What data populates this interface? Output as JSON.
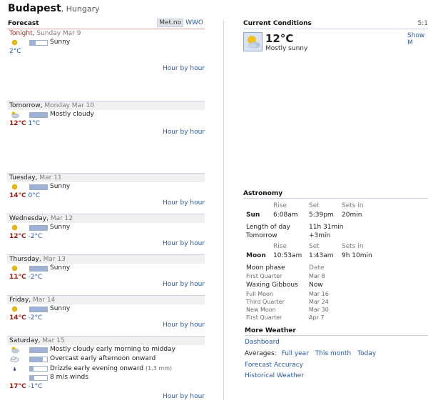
{
  "header": {
    "city": "Budapest",
    "country": ", Hungary"
  },
  "forecast": {
    "label": "Forecast",
    "sources": [
      "Met.no",
      "WWO"
    ],
    "hour_by_hour": "Hour by hour",
    "days": [
      {
        "name": "Tonight",
        "date": "Sunday Mar 9",
        "lines": [
          {
            "icon": "sun-icon",
            "bar": 0.35,
            "text": "Sunny",
            "note": ""
          }
        ],
        "high": "",
        "low": "2°C"
      },
      {
        "name": "Tomorrow",
        "date": "Monday Mar 10",
        "lines": [
          {
            "icon": "partly-cloudy-icon",
            "bar": 1,
            "text": "Mostly cloudy",
            "note": ""
          }
        ],
        "high": "12°C",
        "low": "1°C"
      },
      {
        "name": "Tuesday",
        "date": "Mar 11",
        "lines": [
          {
            "icon": "sun-icon",
            "bar": 1,
            "text": "Sunny",
            "note": ""
          }
        ],
        "high": "14°C",
        "low": "0°C"
      },
      {
        "name": "Wednesday",
        "date": "Mar 12",
        "lines": [
          {
            "icon": "sun-icon",
            "bar": 1,
            "text": "Sunny",
            "note": ""
          }
        ],
        "high": "12°C",
        "low": "-2°C"
      },
      {
        "name": "Thursday",
        "date": "Mar 13",
        "lines": [
          {
            "icon": "sun-icon",
            "bar": 1,
            "text": "Sunny",
            "note": ""
          }
        ],
        "high": "11°C",
        "low": "-2°C"
      },
      {
        "name": "Friday",
        "date": "Mar 14",
        "lines": [
          {
            "icon": "sun-icon",
            "bar": 1,
            "text": "Sunny",
            "note": ""
          }
        ],
        "high": "14°C",
        "low": "-2°C"
      },
      {
        "name": "Saturday",
        "date": "Mar 15",
        "lines": [
          {
            "icon": "partly-cloudy-icon",
            "bar": 1,
            "text": "Mostly cloudy early morning to midday",
            "note": ""
          },
          {
            "icon": "cloud-icon",
            "bar": 0.75,
            "text": "Overcast early afternoon onward",
            "note": ""
          },
          {
            "icon": "drizzle-icon",
            "bar": 0.2,
            "text": "Drizzle early evening onward",
            "note": "(1.3 mm)"
          },
          {
            "icon": "",
            "bar": 0.25,
            "text": "8 m/s winds",
            "note": ""
          }
        ],
        "high": "17°C",
        "low": "-1°C"
      }
    ]
  },
  "current": {
    "title": "Current Conditions",
    "time": "5:1",
    "temp": "12°C",
    "desc": "Mostly sunny",
    "show_more": "Show M",
    "icon": "partly-sunny-icon"
  },
  "astronomy": {
    "title": "Astronomy",
    "col_rise": "Rise",
    "col_set": "Set",
    "col_sets_in": "Sets in",
    "sun_label": "Sun",
    "sun_rise": "6:08am",
    "sun_set": "5:39pm",
    "sun_sets_in": "20min",
    "length_label": "Length of day",
    "length_value": "11h 31min",
    "tomorrow_label": "Tomorrow",
    "tomorrow_value": "+3min",
    "moon_label": "Moon",
    "moon_rise": "10:53am",
    "moon_set": "1:43am",
    "moon_sets_in": "9h 10min",
    "phase_label": "Moon phase",
    "date_label": "Date",
    "phase_prev": "First Quarter",
    "phase_prev_date": "Mar 8",
    "phase_now": "Waxing Gibbous",
    "phase_now_date": "Now",
    "upcoming": [
      {
        "name": "Full Moon",
        "date": "Mar 16"
      },
      {
        "name": "Third Quarter",
        "date": "Mar 24"
      },
      {
        "name": "New Moon",
        "date": "Mar 30"
      },
      {
        "name": "First Quarter",
        "date": "Apr 7"
      }
    ]
  },
  "more_weather": {
    "title": "More Weather",
    "dashboard": "Dashboard",
    "averages_label": "Averages:",
    "full_year": "Full year",
    "this_month": "This month",
    "today": "Today",
    "forecast_accuracy": "Forecast Accuracy",
    "historical": "Historical Weather"
  },
  "colors": {
    "link": "#2759a8",
    "high_temp": "#9b1d12",
    "tonight": "#b8281b"
  }
}
